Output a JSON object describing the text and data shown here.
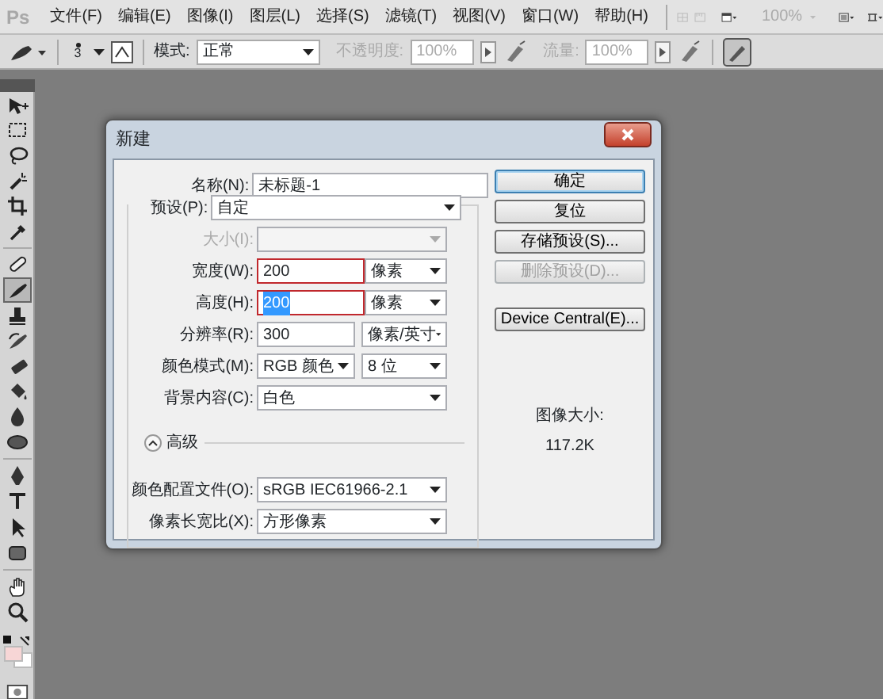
{
  "menubar": {
    "logo": "Ps",
    "menus": [
      "文件(F)",
      "编辑(E)",
      "图像(I)",
      "图层(L)",
      "选择(S)",
      "滤镜(T)",
      "视图(V)",
      "窗口(W)",
      "帮助(H)"
    ],
    "zoom": {
      "value": "100%",
      "disabled": true
    }
  },
  "options_bar": {
    "brush_size": "3",
    "mode_label": "模式:",
    "mode": "正常",
    "opacity": {
      "label": "不透明度:",
      "value": "100%",
      "disabled": true
    },
    "flow": {
      "label": "流量:",
      "value": "100%",
      "disabled": true
    }
  },
  "tool_groups": [
    [
      {
        "kind": "move",
        "selected": false
      },
      {
        "kind": "marquee",
        "selected": false
      },
      {
        "kind": "lasso",
        "selected": false
      },
      {
        "kind": "wand",
        "selected": false
      },
      {
        "kind": "crop",
        "selected": false
      },
      {
        "kind": "eyedropper",
        "selected": false
      }
    ],
    [
      {
        "kind": "heal",
        "selected": false
      },
      {
        "kind": "brush",
        "selected": true
      },
      {
        "kind": "stamp",
        "selected": false
      },
      {
        "kind": "history",
        "selected": false
      },
      {
        "kind": "eraser",
        "selected": false
      },
      {
        "kind": "bucket",
        "selected": false
      },
      {
        "kind": "blur",
        "selected": false
      },
      {
        "kind": "dodge",
        "selected": false
      }
    ],
    [
      {
        "kind": "pen",
        "selected": false
      },
      {
        "kind": "type",
        "selected": false
      },
      {
        "kind": "select",
        "selected": false
      },
      {
        "kind": "shape",
        "selected": false
      }
    ],
    [
      {
        "kind": "hand",
        "selected": false
      },
      {
        "kind": "zoom",
        "selected": false
      }
    ]
  ],
  "dialog": {
    "title": "新建",
    "fields": [
      {
        "kind": "text",
        "label": "名称(N):",
        "value": "未标题-1"
      },
      {
        "kind": "preset",
        "label": "预设(P):",
        "value": "自定"
      },
      {
        "kind": "select",
        "label": "大小(I):",
        "disabled": true
      },
      {
        "kind": "input_unit",
        "label": "宽度(W):",
        "value": "200",
        "unit": "像素",
        "highlighted": true,
        "text_selected": false
      },
      {
        "kind": "input_unit",
        "label": "高度(H):",
        "value": "200",
        "unit": "像素",
        "highlighted": true,
        "text_selected": true
      },
      {
        "kind": "input_unit",
        "label": "分辨率(R):",
        "value": "300",
        "unit": "像素/英寸",
        "highlighted": false,
        "text_selected": false
      },
      {
        "kind": "select_pair",
        "label": "颜色模式(M):",
        "value": "RGB 颜色",
        "unit": "8 位"
      },
      {
        "kind": "select",
        "label": "背景内容(C):",
        "value": "白色",
        "disabled": false
      },
      {
        "kind": "advanced",
        "label": "高级",
        "expanded": true
      },
      {
        "kind": "select",
        "label": "颜色配置文件(O):",
        "value": "sRGB IEC61966-2.1",
        "disabled": false
      },
      {
        "kind": "select",
        "label": "像素长宽比(X):",
        "value": "方形像素",
        "disabled": false
      }
    ],
    "buttons": [
      {
        "label": "确定",
        "default": true,
        "disabled": false
      },
      {
        "label": "复位",
        "default": false,
        "disabled": false
      },
      {
        "label": "存储预设(S)...",
        "default": false,
        "disabled": false
      },
      {
        "label": "删除预设(D)...",
        "default": false,
        "disabled": true
      },
      {
        "label": "Device Central(E)...",
        "default": false,
        "disabled": false
      }
    ],
    "image_size_label": "图像大小:",
    "image_size": "117.2K"
  }
}
